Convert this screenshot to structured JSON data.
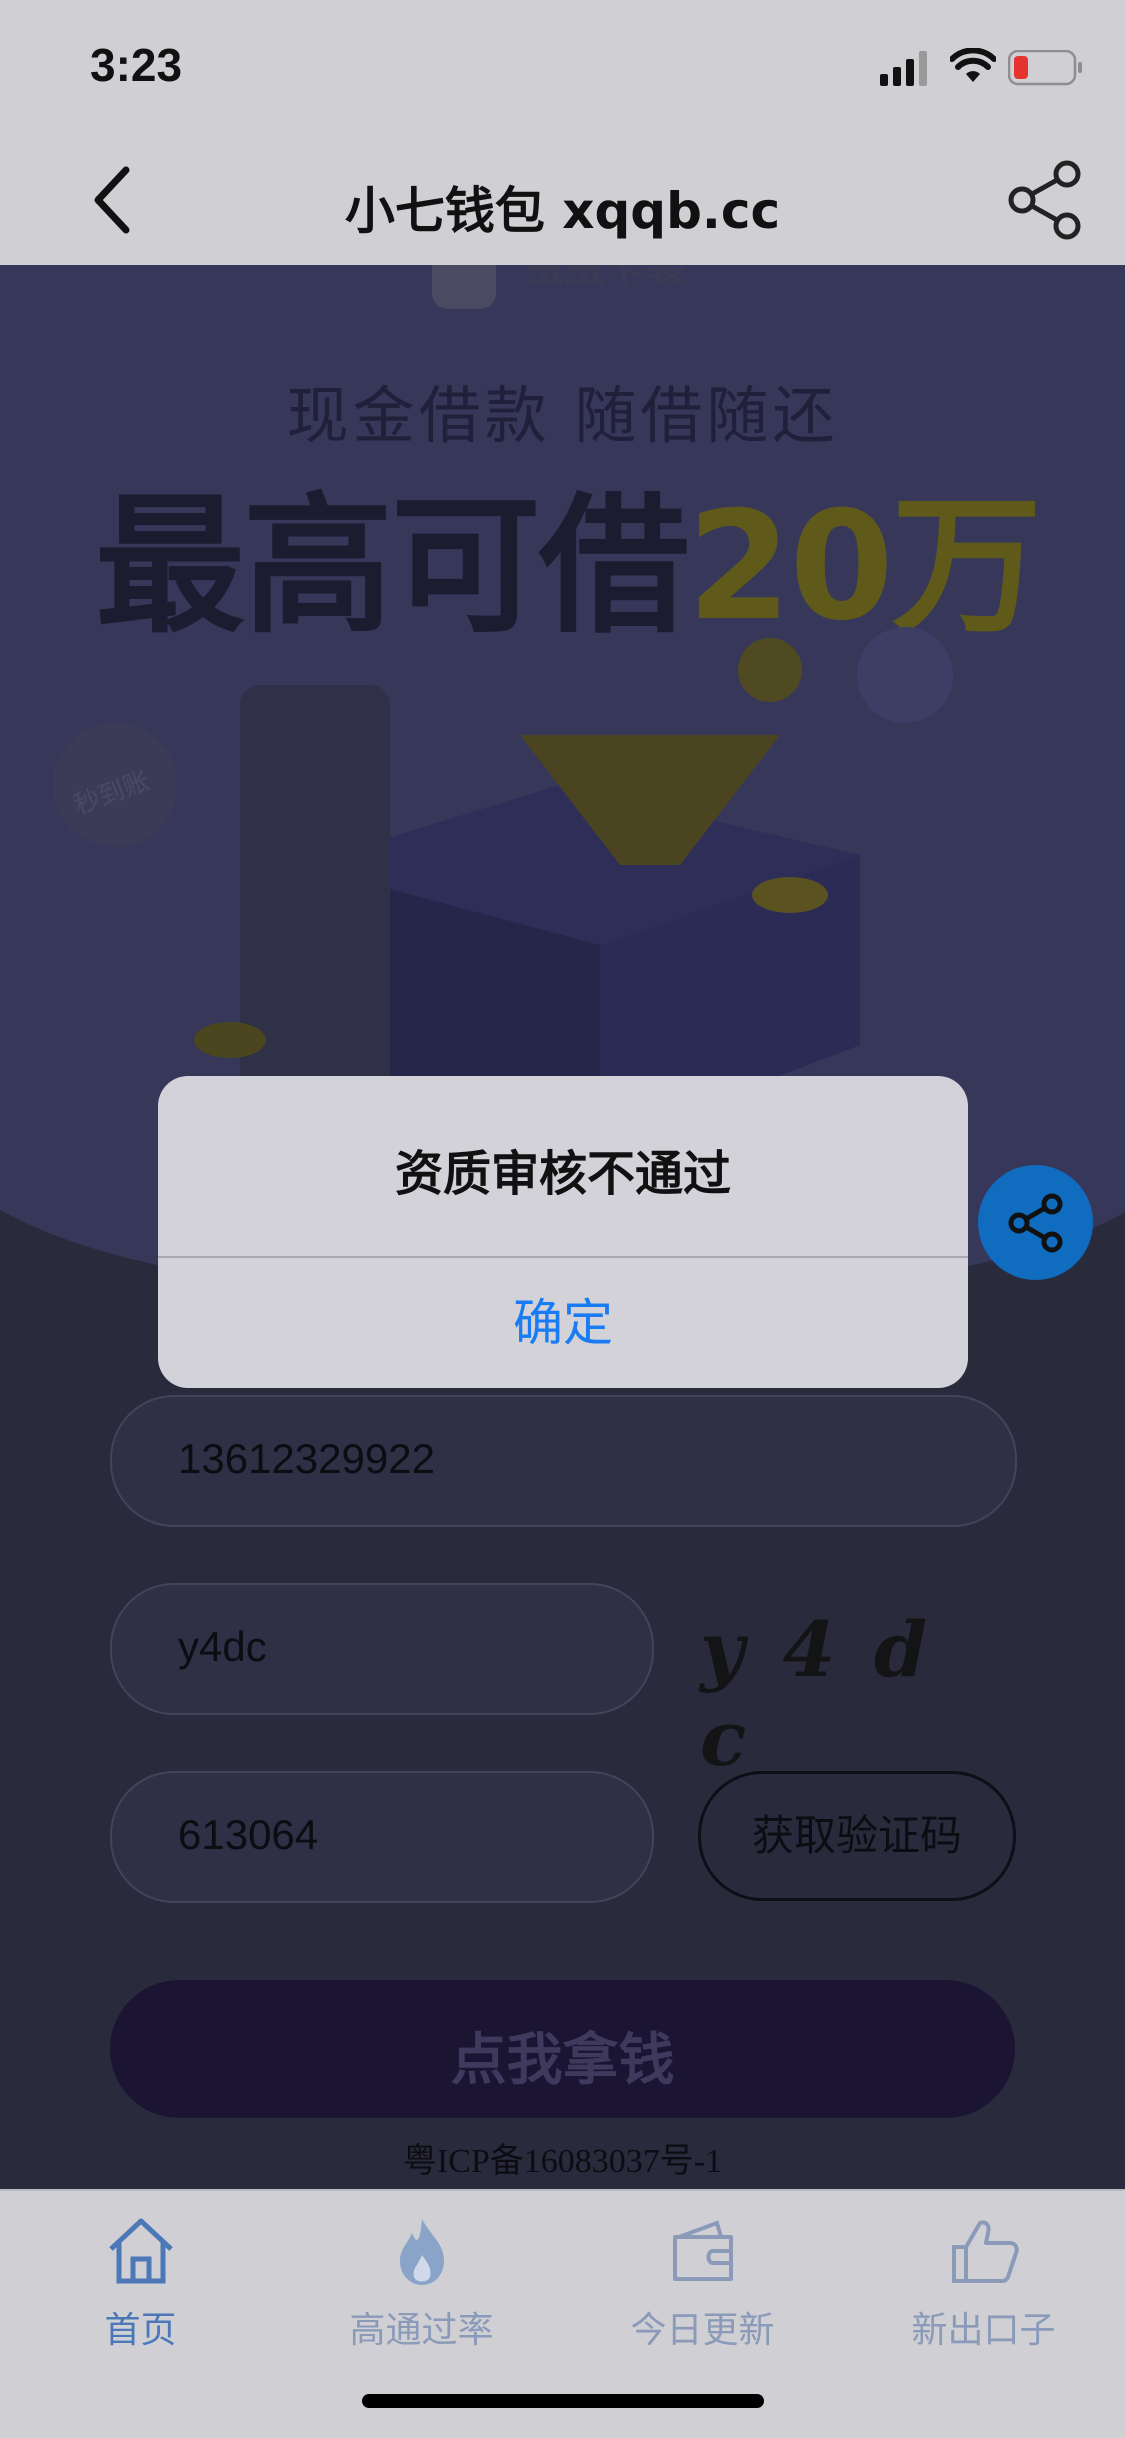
{
  "status_bar": {
    "time": "3:23"
  },
  "nav": {
    "title": "小七钱包 xqqb.cc"
  },
  "hero": {
    "brand": "虫虫卡袋",
    "subtitle": "现金借款  随借随还",
    "headline_main": "最高可借",
    "headline_accent": "20万",
    "badge": "秒到账"
  },
  "form": {
    "phone": "13612329922",
    "captcha_input": "y4dc",
    "captcha_image_text": "y 4 d c",
    "sms_code": "613064",
    "get_code_label": "获取验证码",
    "submit_label": "点我拿钱"
  },
  "footer": {
    "icp": "粤ICP备16083037号-1"
  },
  "tabs": [
    {
      "label": "首页",
      "icon": "home-icon",
      "active": true
    },
    {
      "label": "高通过率",
      "icon": "flame-icon",
      "active": false
    },
    {
      "label": "今日更新",
      "icon": "wallet-icon",
      "active": false
    },
    {
      "label": "新出口子",
      "icon": "thumbs-up-icon",
      "active": false
    }
  ],
  "alert": {
    "title": "资质审核不通过",
    "confirm_label": "确定"
  },
  "colors": {
    "accent_blue": "#1a7cf5",
    "fab_blue": "#0f6cbf",
    "cta_purple": "#1b1533"
  }
}
